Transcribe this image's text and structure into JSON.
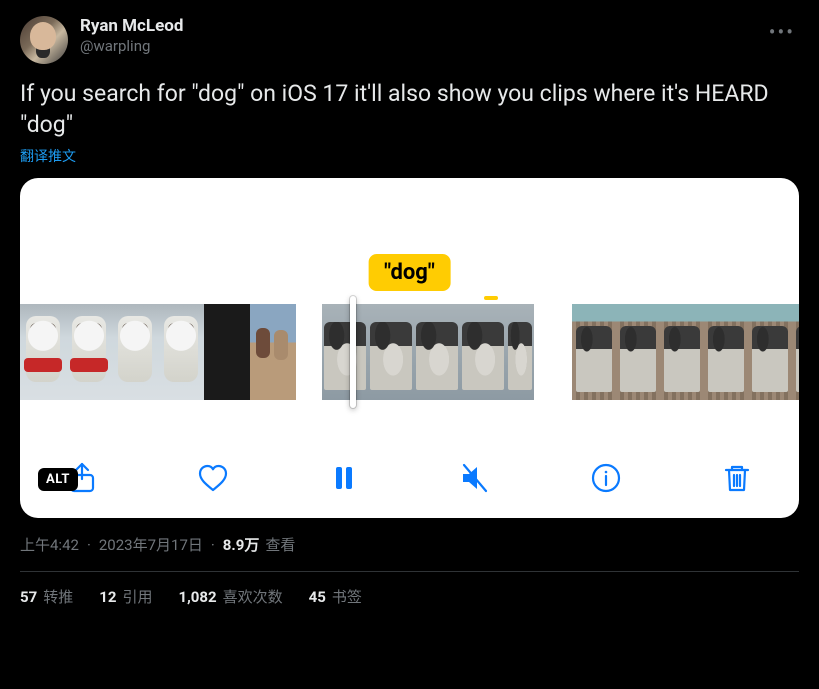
{
  "author": {
    "display_name": "Ryan McLeod",
    "handle": "@warpling"
  },
  "tweet_text": "If you search for \"dog\" on iOS 17 it'll also show you clips where it's HEARD \"dog\"",
  "translate_label": "翻译推文",
  "media": {
    "caption_bubble": "\"dog\"",
    "alt_badge": "ALT",
    "toolbar_icons": {
      "share": "share-icon",
      "heart": "heart-icon",
      "pause": "pause-icon",
      "mute": "mute-icon",
      "info": "info-icon",
      "trash": "trash-icon"
    }
  },
  "meta": {
    "time": "上午4:42",
    "date": "2023年7月17日",
    "views_count": "8.9万",
    "views_label": "查看"
  },
  "stats": {
    "retweets_count": "57",
    "retweets_label": "转推",
    "quotes_count": "12",
    "quotes_label": "引用",
    "likes_count": "1,082",
    "likes_label": "喜欢次数",
    "bookmarks_count": "45",
    "bookmarks_label": "书签"
  }
}
